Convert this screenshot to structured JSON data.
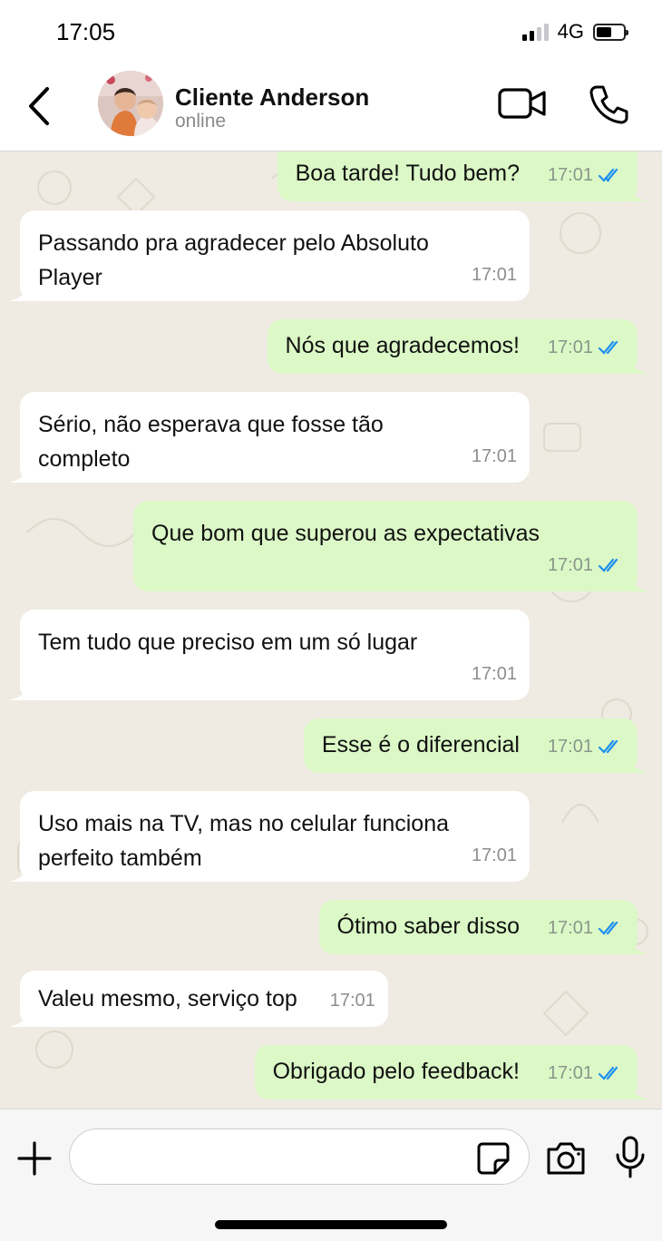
{
  "status_bar": {
    "time": "17:05",
    "network": "4G"
  },
  "header": {
    "contact_name": "Cliente Anderson",
    "contact_status": "online",
    "icons": [
      "back-icon",
      "video-call-icon",
      "phone-icon"
    ]
  },
  "messages": [
    {
      "direction": "out",
      "text": "Boa tarde! Tudo bem?",
      "time": "17:01",
      "status": "read"
    },
    {
      "direction": "in",
      "text": "Passando pra agradecer pelo Absoluto\nPlayer",
      "time": "17:01"
    },
    {
      "direction": "out",
      "text": "Nós que agradecemos!",
      "time": "17:01",
      "status": "read"
    },
    {
      "direction": "in",
      "text": "Sério, não esperava que fosse tão\ncompleto",
      "time": "17:01"
    },
    {
      "direction": "out",
      "text": "Que bom que superou as expectativas",
      "time": "17:01",
      "status": "read"
    },
    {
      "direction": "in",
      "text": "Tem tudo que preciso em um só lugar",
      "time": "17:01"
    },
    {
      "direction": "out",
      "text": "Esse é o diferencial",
      "time": "17:01",
      "status": "read"
    },
    {
      "direction": "in",
      "text": "Uso mais na TV, mas no celular funciona\nperfeito também",
      "time": "17:01"
    },
    {
      "direction": "out",
      "text": "Ótimo saber disso",
      "time": "17:01",
      "status": "read"
    },
    {
      "direction": "in",
      "text": "Valeu mesmo, serviço top",
      "time": "17:01"
    },
    {
      "direction": "out",
      "text": "Obrigado pelo feedback!",
      "time": "17:01",
      "status": "read"
    }
  ],
  "composer": {
    "value": "",
    "icons": [
      "plus-icon",
      "sticker-icon",
      "camera-icon",
      "microphone-icon"
    ]
  },
  "colors": {
    "incoming_bubble": "#ffffff",
    "outgoing_bubble": "#dbf8c6",
    "read_ticks": "#1d8ff0",
    "wallpaper": "#efeae2"
  }
}
